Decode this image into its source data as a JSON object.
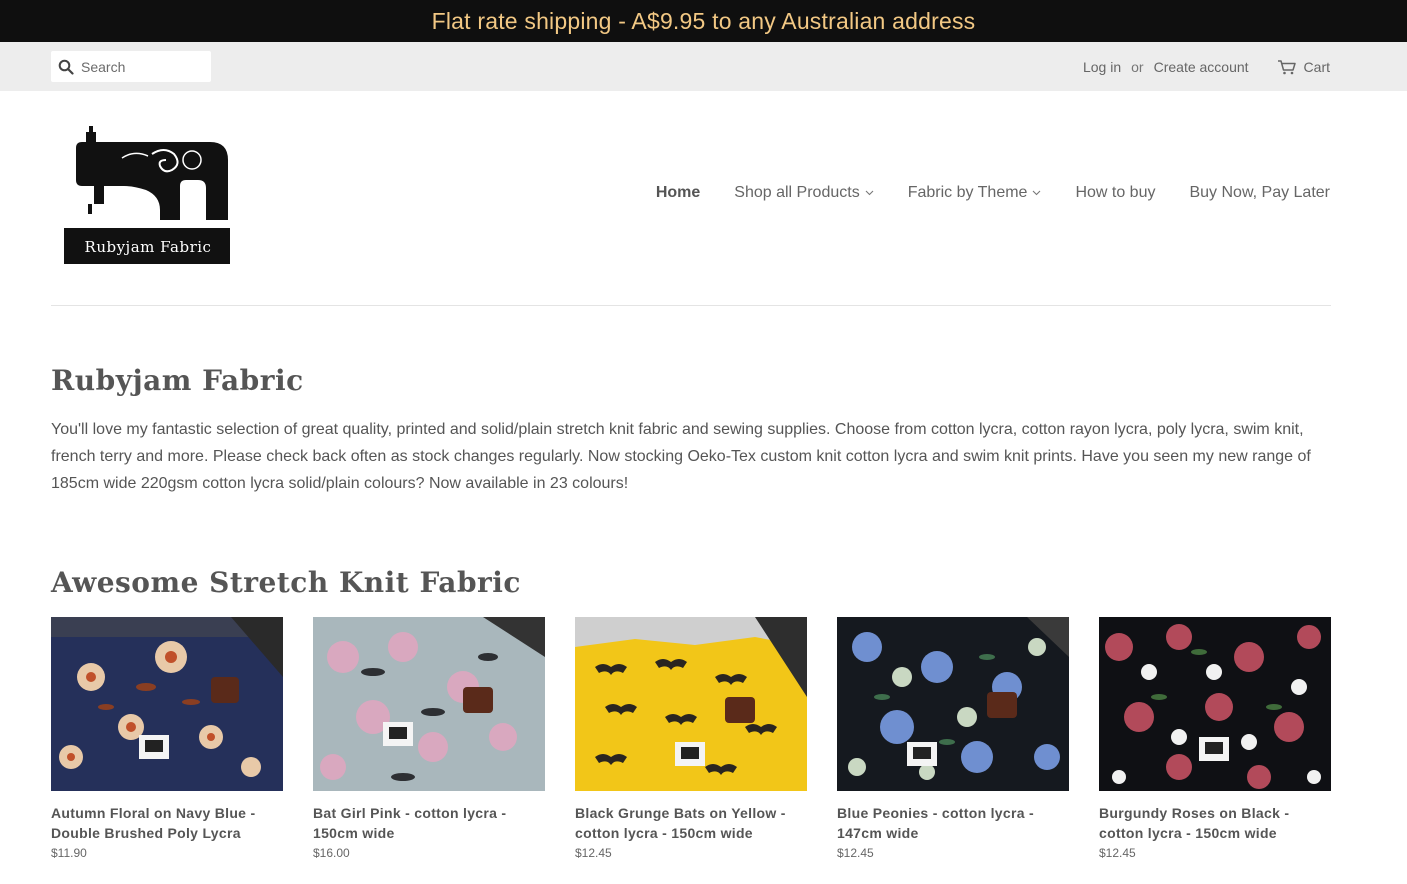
{
  "announcement": "Flat rate shipping - A$9.95 to any Australian address",
  "search": {
    "placeholder": "Search"
  },
  "account": {
    "login": "Log in",
    "or": "or",
    "create": "Create account",
    "cart": "Cart"
  },
  "logo": {
    "text": "Rubyjam Fabric"
  },
  "nav": [
    {
      "label": "Home",
      "active": true,
      "dropdown": false
    },
    {
      "label": "Shop all Products",
      "active": false,
      "dropdown": true
    },
    {
      "label": "Fabric by Theme",
      "active": false,
      "dropdown": true
    },
    {
      "label": "How to buy",
      "active": false,
      "dropdown": false
    },
    {
      "label": "Buy Now, Pay Later",
      "active": false,
      "dropdown": false
    }
  ],
  "page": {
    "title": "Rubyjam Fabric",
    "intro": "You'll love my fantastic selection of great quality, printed and solid/plain stretch knit fabric and sewing supplies. Choose from cotton lycra, cotton rayon lycra, poly lycra, swim knit, french terry and more. Please check back often as stock changes regularly. Now stocking Oeko-Tex custom knit cotton lycra and swim knit prints. Have you seen my new range of 185cm wide 220gsm cotton lycra solid/plain colours? Now available in 23 colours!"
  },
  "collection": {
    "title": "Awesome Stretch Knit Fabric",
    "products": [
      {
        "name": "Autumn Floral on Navy Blue - Double Brushed Poly Lycra",
        "price": "$11.90"
      },
      {
        "name": "Bat Girl Pink - cotton lycra - 150cm wide",
        "price": "$16.00"
      },
      {
        "name": "Black Grunge Bats on Yellow - cotton lycra - 150cm wide",
        "price": "$12.45"
      },
      {
        "name": "Blue Peonies - cotton lycra - 147cm wide",
        "price": "$12.45"
      },
      {
        "name": "Burgundy Roses on Black - cotton lycra - 150cm wide",
        "price": "$12.45"
      }
    ]
  },
  "colors": {
    "announcement_bg": "#0f0f0f",
    "announcement_text": "#f2c884",
    "utility_bg": "#ededed",
    "text": "#555555"
  }
}
